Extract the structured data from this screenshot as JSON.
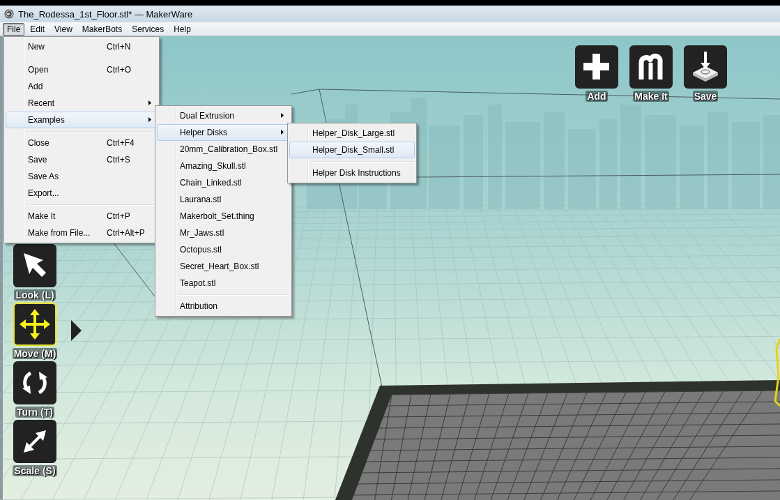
{
  "window": {
    "title": "The_Rodessa_1st_Floor.stl* — MakerWare"
  },
  "menu_bar": [
    {
      "label": "File",
      "selected": true
    },
    {
      "label": "Edit",
      "selected": false
    },
    {
      "label": "View",
      "selected": false
    },
    {
      "label": "MakerBots",
      "selected": false
    },
    {
      "label": "Services",
      "selected": false
    },
    {
      "label": "Help",
      "selected": false
    }
  ],
  "file_menu": [
    {
      "kind": "item",
      "label": "New",
      "shortcut": "Ctrl+N",
      "selected": false
    },
    {
      "kind": "separator"
    },
    {
      "kind": "item",
      "label": "Open",
      "shortcut": "Ctrl+O",
      "selected": false
    },
    {
      "kind": "item",
      "label": "Add",
      "selected": false
    },
    {
      "kind": "submenu",
      "label": "Recent",
      "selected": false
    },
    {
      "kind": "submenu",
      "label": "Examples",
      "selected": true
    },
    {
      "kind": "separator"
    },
    {
      "kind": "item",
      "label": "Close",
      "shortcut": "Ctrl+F4",
      "selected": false
    },
    {
      "kind": "item",
      "label": "Save",
      "shortcut": "Ctrl+S",
      "selected": false
    },
    {
      "kind": "item",
      "label": "Save As",
      "selected": false
    },
    {
      "kind": "item",
      "label": "Export...",
      "selected": false
    },
    {
      "kind": "separator"
    },
    {
      "kind": "item",
      "label": "Make It",
      "shortcut": "Ctrl+P",
      "selected": false
    },
    {
      "kind": "item",
      "label": "Make from File...",
      "shortcut": "Ctrl+Alt+P",
      "selected": false
    }
  ],
  "examples_menu": [
    {
      "kind": "submenu",
      "label": "Dual Extrusion",
      "selected": false
    },
    {
      "kind": "submenu",
      "label": "Helper Disks",
      "selected": true
    },
    {
      "kind": "item",
      "label": "20mm_Calibration_Box.stl",
      "selected": false
    },
    {
      "kind": "item",
      "label": "Amazing_Skull.stl",
      "selected": false
    },
    {
      "kind": "item",
      "label": "Chain_Linked.stl",
      "selected": false
    },
    {
      "kind": "item",
      "label": "Laurana.stl",
      "selected": false
    },
    {
      "kind": "item",
      "label": "Makerbolt_Set.thing",
      "selected": false
    },
    {
      "kind": "item",
      "label": "Mr_Jaws.stl",
      "selected": false
    },
    {
      "kind": "item",
      "label": "Octopus.stl",
      "selected": false
    },
    {
      "kind": "item",
      "label": "Secret_Heart_Box.stl",
      "selected": false
    },
    {
      "kind": "item",
      "label": "Teapot.stl",
      "selected": false
    },
    {
      "kind": "separator"
    },
    {
      "kind": "item",
      "label": "Attribution",
      "selected": false
    }
  ],
  "helper_disks_menu": [
    {
      "kind": "item",
      "label": "Helper_Disk_Large.stl",
      "selected": false
    },
    {
      "kind": "item",
      "label": "Helper_Disk_Small.stl",
      "selected": true
    },
    {
      "kind": "separator"
    },
    {
      "kind": "item",
      "label": "Helper Disk Instructions",
      "selected": false
    }
  ],
  "action_toolbar": [
    {
      "label": "Add"
    },
    {
      "label": "Make It"
    },
    {
      "label": "Save"
    }
  ],
  "tools": [
    {
      "label": "Look (L)",
      "selected": false
    },
    {
      "label": "Move (M)",
      "selected": true
    },
    {
      "label": "Turn (T)",
      "selected": false
    },
    {
      "label": "Scale (S)",
      "selected": false
    }
  ]
}
